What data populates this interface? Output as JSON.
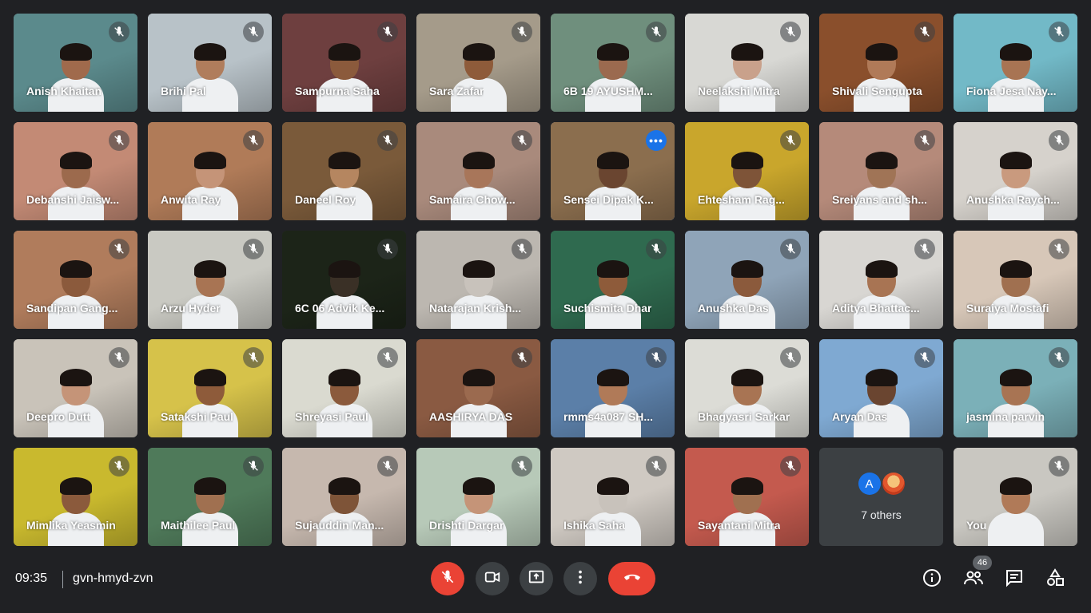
{
  "meeting": {
    "time": "09:35",
    "code": "gvn-hmyd-zvn",
    "participant_count": "46"
  },
  "participants": [
    {
      "name": "Anish Khaitan",
      "bg": "#5b8a8c",
      "skin": "#a06a4c",
      "muted": true
    },
    {
      "name": "Brihi Pal",
      "bg": "#b8c2c8",
      "skin": "#b07d5c",
      "muted": true
    },
    {
      "name": "Sampurna Saha",
      "bg": "#6e3f3f",
      "skin": "#8b5a3c",
      "muted": true
    },
    {
      "name": "Sara Zafar",
      "bg": "#a59b8a",
      "skin": "#8e5b3a",
      "muted": true
    },
    {
      "name": "6B 19 AYUSHM...",
      "bg": "#6f8f7d",
      "skin": "#9b6a4f",
      "muted": true
    },
    {
      "name": "Neelakshi Mitra",
      "bg": "#d8d8d4",
      "skin": "#c9a18b",
      "muted": true
    },
    {
      "name": "Shivali Sengupta",
      "bg": "#8a4f2c",
      "skin": "#b07a58",
      "muted": true
    },
    {
      "name": "Fiona Jesa Nay...",
      "bg": "#72b9c7",
      "skin": "#a87453",
      "muted": true
    },
    {
      "name": "Debanshi Jaisw...",
      "bg": "#c38a75",
      "skin": "#9c6a4d",
      "muted": true
    },
    {
      "name": "Anwita Ray",
      "bg": "#b07b58",
      "skin": "#c59478",
      "muted": true
    },
    {
      "name": "Daneel Roy",
      "bg": "#7a5a3a",
      "skin": "#b58660",
      "muted": true
    },
    {
      "name": "Samaira Chow...",
      "bg": "#a98a7c",
      "skin": "#a8765a",
      "muted": true
    },
    {
      "name": "Sensei Dipak K...",
      "bg": "#8b6e4e",
      "skin": "#6a4530",
      "muted": false
    },
    {
      "name": "Ehtesham Rag...",
      "bg": "#c9a62c",
      "skin": "#7e5438",
      "muted": true
    },
    {
      "name": "Sreiyans and sh...",
      "bg": "#b58a7a",
      "skin": "#a07456",
      "muted": true
    },
    {
      "name": "Anushka Raych...",
      "bg": "#d6d2cc",
      "skin": "#c99a7e",
      "muted": true
    },
    {
      "name": "Sandipan Gang...",
      "bg": "#b07c5c",
      "skin": "#8b5a3c",
      "muted": true
    },
    {
      "name": "Arzu Hyder",
      "bg": "#c9c9c2",
      "skin": "#a87453",
      "muted": true
    },
    {
      "name": "6C 06 Advik Ke...",
      "bg": "#1c2418",
      "skin": "#3a3026",
      "muted": true
    },
    {
      "name": "Natarajan Krish...",
      "bg": "#bcb7b0",
      "skin": "#c8c2bb",
      "muted": true
    },
    {
      "name": "Suchismita Dhar",
      "bg": "#2f6a4f",
      "skin": "#8e5b3a",
      "muted": true
    },
    {
      "name": "Anushka Das",
      "bg": "#8fa4b8",
      "skin": "#8b5a3c",
      "muted": true
    },
    {
      "name": "Aditya Bhattac...",
      "bg": "#d8d6d2",
      "skin": "#a87453",
      "muted": true
    },
    {
      "name": "Suraiya Mostafi",
      "bg": "#d7c7b8",
      "skin": "#a07050",
      "muted": true
    },
    {
      "name": "Deepro Dutt",
      "bg": "#c9c3b9",
      "skin": "#c59478",
      "muted": true
    },
    {
      "name": "Satakshi Paul",
      "bg": "#d6c24a",
      "skin": "#8e5b3a",
      "muted": true
    },
    {
      "name": "Shreyasi Paul",
      "bg": "#dadad0",
      "skin": "#8b5a3c",
      "muted": true
    },
    {
      "name": "AASHIRYA DAS",
      "bg": "#8a5a42",
      "skin": "#9b6a4f",
      "muted": true
    },
    {
      "name": "rmms4a087 SH...",
      "bg": "#5b7fa8",
      "skin": "#b07a58",
      "muted": true
    },
    {
      "name": "Bhagyasri Sarkar",
      "bg": "#dcdcd6",
      "skin": "#a87453",
      "muted": true
    },
    {
      "name": "Aryan Das",
      "bg": "#7fa9d2",
      "skin": "#6a4530",
      "muted": true
    },
    {
      "name": "jasmina parvin",
      "bg": "#7bb0b8",
      "skin": "#a87453",
      "muted": true
    },
    {
      "name": "Mimlika Yeasmin",
      "bg": "#c9b92e",
      "skin": "#8b5a3c",
      "muted": true
    },
    {
      "name": "Maithilee Paul",
      "bg": "#4f7a5a",
      "skin": "#a07050",
      "muted": true
    },
    {
      "name": "Sujauddin Man...",
      "bg": "#c6b8ae",
      "skin": "#7e5438",
      "muted": true
    },
    {
      "name": "Drishti Dargar",
      "bg": "#b7c9b8",
      "skin": "#c59478",
      "muted": true
    },
    {
      "name": "Ishika Saha",
      "bg": "#cfc9c2",
      "skin": "#c8c2bb",
      "muted": true
    },
    {
      "name": "Sayantani Mitra",
      "bg": "#c45a4e",
      "skin": "#a07050",
      "muted": true
    }
  ],
  "others": {
    "avatar_letter": "A",
    "label": "7 others"
  },
  "self": {
    "name": "You",
    "bg": "#c9c7c1",
    "skin": "#b07a58"
  },
  "colors": {
    "background": "#202124",
    "tile": "#3c4043",
    "red": "#ea4335",
    "blue": "#1a73e8",
    "speaking_border": "#8ab4f8"
  },
  "icons": {
    "mic_off": "mic-off-icon",
    "camera": "videocam-icon",
    "present": "present-screen-icon",
    "more": "more-vert-icon",
    "hangup": "call-end-icon",
    "info": "info-icon",
    "people": "people-icon",
    "chat": "chat-icon",
    "activities": "activities-icon"
  }
}
